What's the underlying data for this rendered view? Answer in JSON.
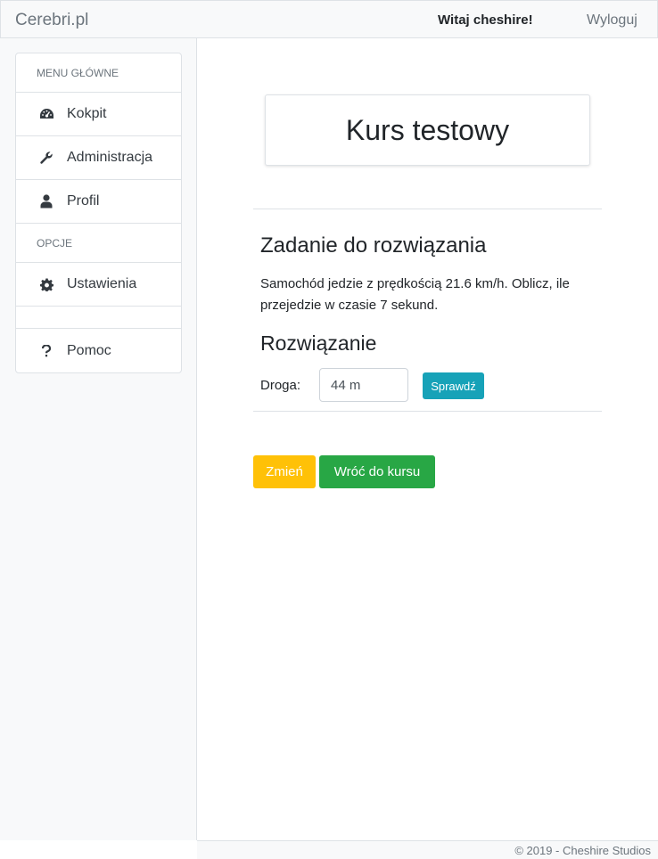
{
  "navbar": {
    "brand": "Cerebri.pl",
    "welcome": "Witaj cheshire!",
    "logout": "Wyloguj"
  },
  "sidebar": {
    "main_header": "MENU GŁÓWNE",
    "items": [
      {
        "label": "Kokpit",
        "icon": "dashboard-icon"
      },
      {
        "label": "Administracja",
        "icon": "wrench-icon"
      },
      {
        "label": "Profil",
        "icon": "user-icon"
      }
    ],
    "options_header": "OPCJE",
    "option_items": [
      {
        "label": "Ustawienia",
        "icon": "gear-icon"
      }
    ],
    "help": {
      "label": "Pomoc",
      "icon": "question-icon"
    }
  },
  "course": {
    "title": "Kurs testowy"
  },
  "task": {
    "title": "Zadanie do rozwiązania",
    "text": "Samochód jedzie z prędkością 21.6 km/h. Oblicz, ile przejedzie w czasie 7 sekund."
  },
  "solution": {
    "title": "Rozwiązanie",
    "field_label": "Droga:",
    "field_value": "44 m",
    "check_button": "Sprawdź"
  },
  "actions": {
    "change_button": "Zmień",
    "back_button": "Wróć do kursu"
  },
  "footer": {
    "text": "© 2019 - Cheshire Studios"
  },
  "colors": {
    "info": "#17a2b8",
    "warning": "#ffc107",
    "success": "#28a745"
  }
}
